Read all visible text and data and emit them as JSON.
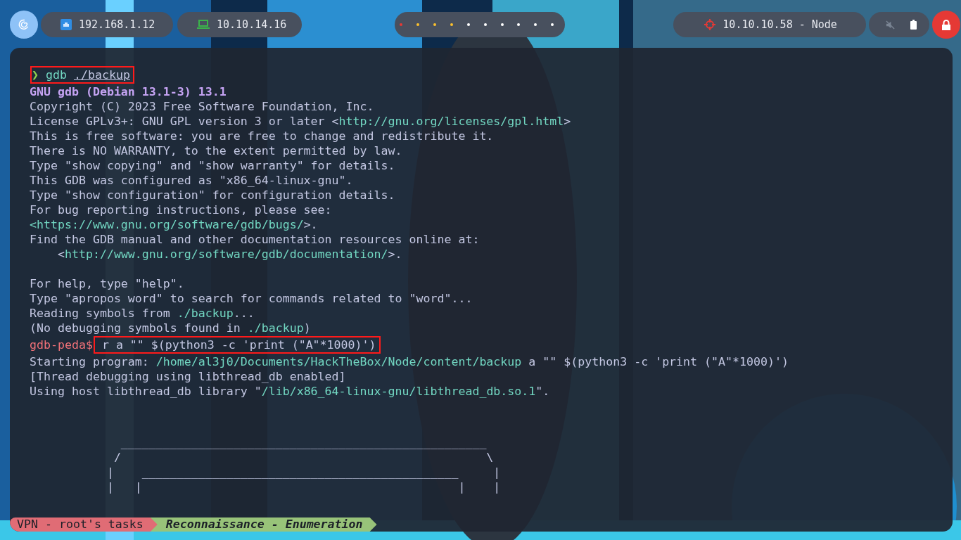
{
  "top_bar": {
    "network_pills": [
      {
        "kind": "ethernet",
        "label": "192.168.1.12"
      },
      {
        "kind": "vpn",
        "label": "10.10.14.16"
      }
    ],
    "workspaces": [
      {
        "color": "#e53935"
      },
      {
        "color": "#fbc02d"
      },
      {
        "color": "#fbc02d"
      },
      {
        "color": "#fbc02d"
      },
      {
        "color": "#ffffff"
      },
      {
        "color": "#ffffff"
      },
      {
        "color": "#ffffff"
      },
      {
        "color": "#ffffff"
      },
      {
        "color": "#ffffff"
      },
      {
        "color": "#ffffff"
      }
    ],
    "target": {
      "label": "10.10.10.58 - Node"
    }
  },
  "terminal": {
    "lines": [
      {
        "segments": [
          {
            "kind": "arrow",
            "text": "❯",
            "boxed": true
          },
          {
            "kind": "command",
            "text": " gdb ",
            "boxed": true
          },
          {
            "kind": "path",
            "text": "./backup",
            "boxed": true
          }
        ]
      },
      {
        "segments": [
          {
            "kind": "bold",
            "text": "GNU gdb (Debian 13.1-3) 13.1"
          }
        ]
      },
      {
        "segments": [
          {
            "kind": "plain",
            "text": "Copyright (C) 2023 Free Software Foundation, Inc."
          }
        ]
      },
      {
        "segments": [
          {
            "kind": "plain",
            "text": "License GPLv3+: GNU GPL version 3 or later <"
          },
          {
            "kind": "link",
            "text": "http://gnu.org/licenses/gpl.html"
          },
          {
            "kind": "plain",
            "text": ">"
          }
        ]
      },
      {
        "segments": [
          {
            "kind": "plain",
            "text": "This is free software: you are free to change and redistribute it."
          }
        ]
      },
      {
        "segments": [
          {
            "kind": "plain",
            "text": "There is NO WARRANTY, to the extent permitted by law."
          }
        ]
      },
      {
        "segments": [
          {
            "kind": "plain",
            "text": "Type \"show copying\" and \"show warranty\" for details."
          }
        ]
      },
      {
        "segments": [
          {
            "kind": "plain",
            "text": "This GDB was configured as \"x86_64-linux-gnu\"."
          }
        ]
      },
      {
        "segments": [
          {
            "kind": "plain",
            "text": "Type \"show configuration\" for configuration details."
          }
        ]
      },
      {
        "segments": [
          {
            "kind": "plain",
            "text": "For bug reporting instructions, please see:"
          }
        ]
      },
      {
        "segments": [
          {
            "kind": "link",
            "text": "<https://www.gnu.org/software/gdb/bugs/"
          },
          {
            "kind": "plain",
            "text": ">."
          }
        ]
      },
      {
        "segments": [
          {
            "kind": "plain",
            "text": "Find the GDB manual and other documentation resources online at:"
          }
        ]
      },
      {
        "segments": [
          {
            "kind": "plain",
            "text": "    <"
          },
          {
            "kind": "link",
            "text": "http://www.gnu.org/software/gdb/documentation/"
          },
          {
            "kind": "plain",
            "text": ">."
          }
        ]
      },
      {
        "gap_before": true,
        "segments": [
          {
            "kind": "plain",
            "text": "For help, type \"help\"."
          }
        ]
      },
      {
        "segments": [
          {
            "kind": "plain",
            "text": "Type \"apropos word\" to search for commands related to \"word\"..."
          }
        ]
      },
      {
        "segments": [
          {
            "kind": "plain",
            "text": "Reading symbols from "
          },
          {
            "kind": "link",
            "text": "./backup"
          },
          {
            "kind": "plain",
            "text": "..."
          }
        ]
      },
      {
        "segments": [
          {
            "kind": "plain",
            "text": "(No debugging symbols found in "
          },
          {
            "kind": "link",
            "text": "./backup"
          },
          {
            "kind": "plain",
            "text": ")"
          }
        ]
      },
      {
        "segments": [
          {
            "kind": "peda",
            "text": "gdb-peda$"
          },
          {
            "kind": "plain",
            "text": " r a \"\" $(python3 -c 'print (\"A\"*1000)')",
            "boxed": true
          }
        ]
      },
      {
        "segments": [
          {
            "kind": "plain",
            "text": "Starting program: "
          },
          {
            "kind": "link",
            "text": "/home/al3j0/Documents/HackTheBox/Node/content/backup"
          },
          {
            "kind": "plain",
            "text": " a \"\" $(python3 -c 'print (\"A\"*1000)')"
          }
        ]
      },
      {
        "segments": [
          {
            "kind": "plain",
            "text": "[Thread debugging using libthread_db enabled]"
          }
        ]
      },
      {
        "segments": [
          {
            "kind": "plain",
            "text": "Using host libthread_db library \""
          },
          {
            "kind": "link",
            "text": "/lib/x86_64-linux-gnu/libthread_db.so.1"
          },
          {
            "kind": "plain",
            "text": "\"."
          }
        ]
      }
    ],
    "ascii_art": [
      "             ____________________________________________________",
      "            /                                                    \\",
      "           |    _____________________________________________     |",
      "           |   |                                             |    |"
    ]
  },
  "status_bar": {
    "segments": [
      {
        "kind": "session",
        "label": "VPN - root's tasks",
        "color": "#e06c75"
      },
      {
        "kind": "task",
        "label": "Reconnaissance - Enumeration",
        "color": "#98c379"
      }
    ]
  }
}
